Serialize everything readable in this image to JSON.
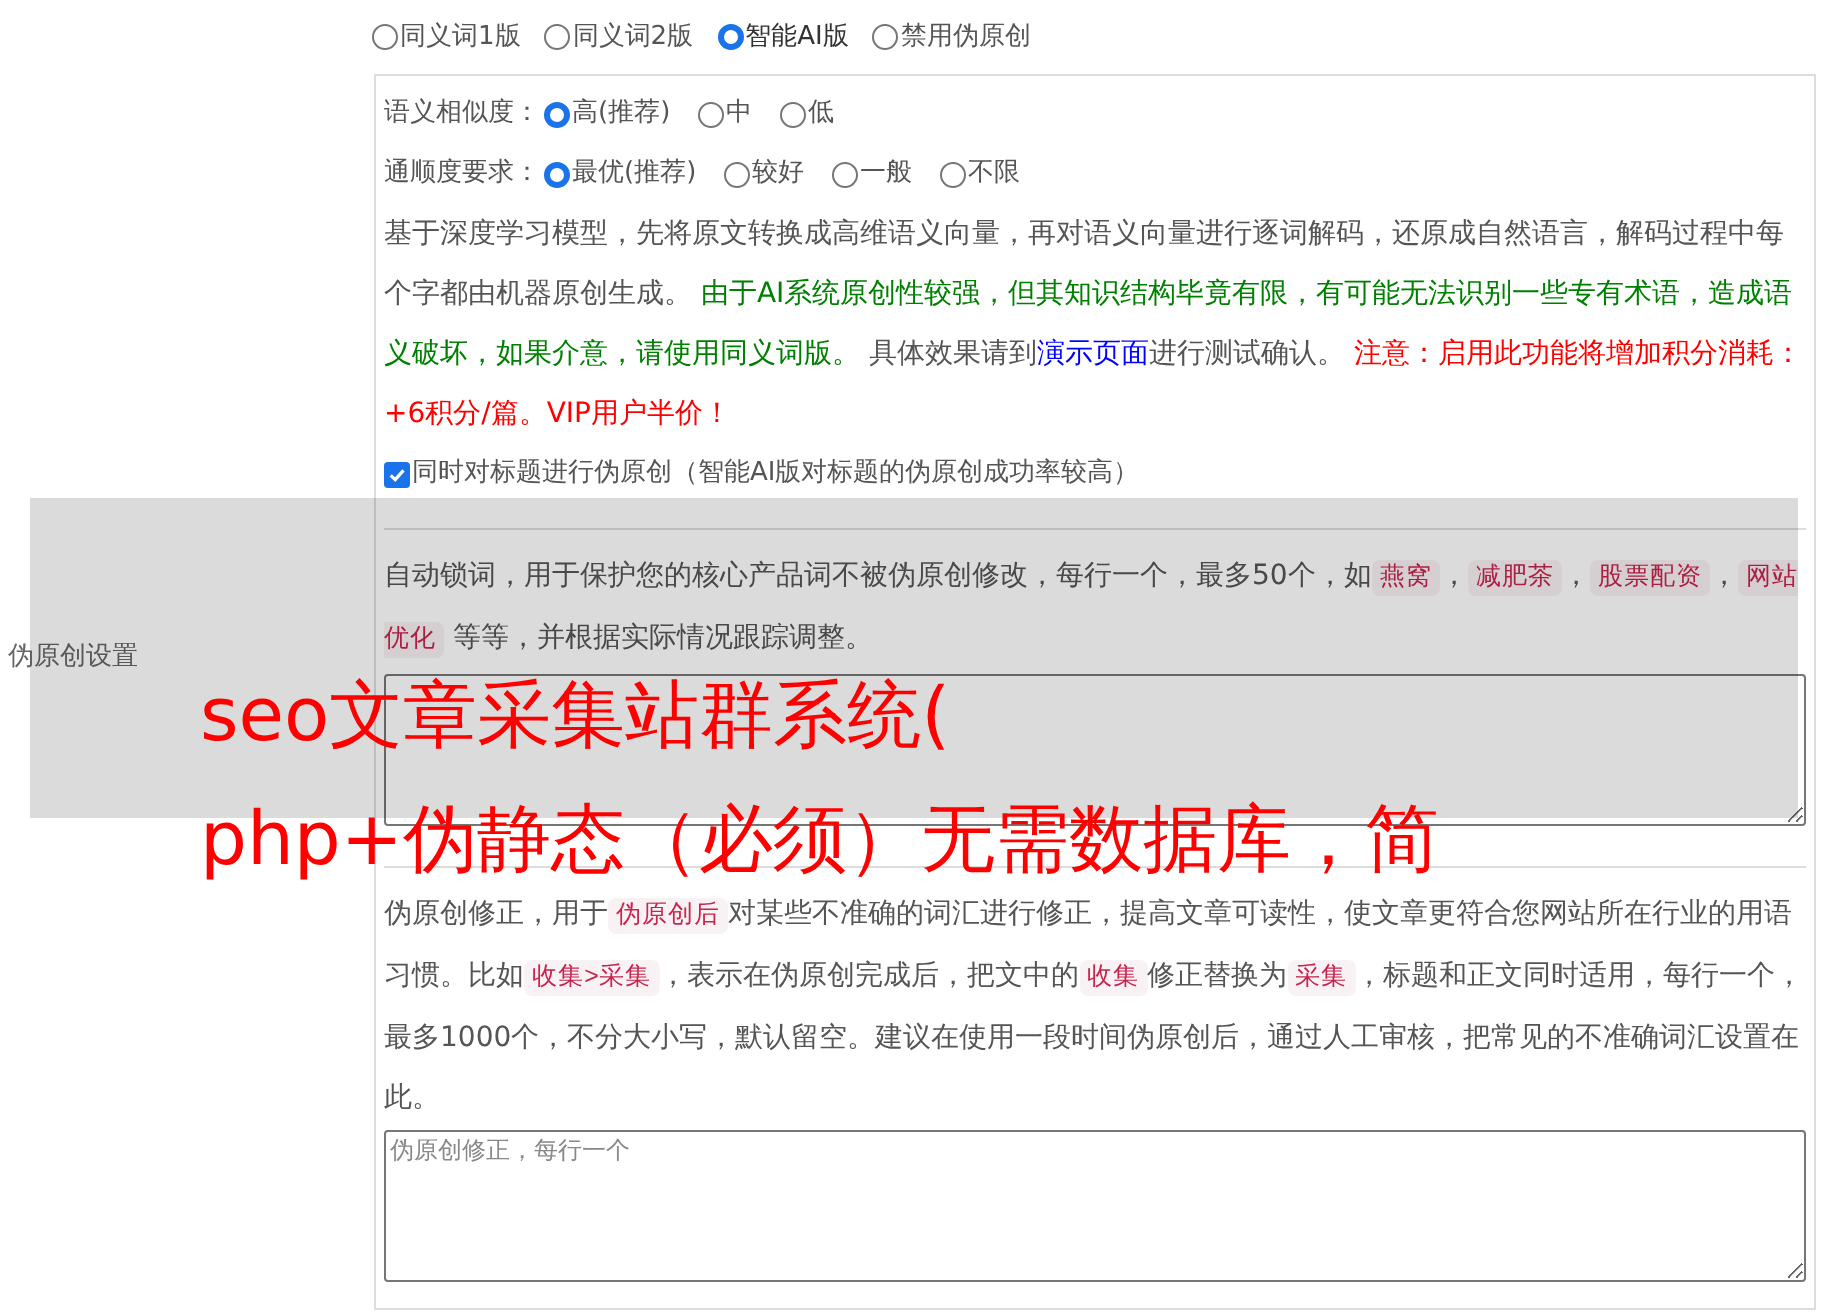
{
  "section_label": "伪原创设置",
  "mode_options": [
    {
      "label": "同义词1版",
      "selected": false
    },
    {
      "label": "同义词2版",
      "selected": false
    },
    {
      "label": "智能AI版",
      "selected": true
    },
    {
      "label": "禁用伪原创",
      "selected": false
    }
  ],
  "settings": [
    {
      "label": "语义相似度：",
      "options": [
        {
          "label": "高(推荐)",
          "selected": true
        },
        {
          "label": "中",
          "selected": false
        },
        {
          "label": "低",
          "selected": false
        }
      ]
    },
    {
      "label": "通顺度要求：",
      "options": [
        {
          "label": "最优(推荐)",
          "selected": true
        },
        {
          "label": "较好",
          "selected": false
        },
        {
          "label": "一般",
          "selected": false
        },
        {
          "label": "不限",
          "selected": false
        }
      ]
    }
  ],
  "ai_description": [
    {
      "kind": "text",
      "text": "基于深度学习模型，先将原文转换成高维语义向量，再对语义向量进行逐词解码，还原成自然语言，解码过程中每个字都由机器原创生成。 "
    },
    {
      "kind": "success",
      "text": "由于AI系统原创性较强，但其知识结构毕竟有限，有可能无法识别一些专有术语，造成语义破坏，如果介意，请使用同义词版。"
    },
    {
      "kind": "text",
      "text": " 具体效果请到"
    },
    {
      "kind": "link",
      "text": "演示页面"
    },
    {
      "kind": "text",
      "text": "进行测试确认。 "
    },
    {
      "kind": "warning",
      "text": "注意：启用此功能将增加积分消耗：+6积分/篇。VIP用户半价！"
    }
  ],
  "title_option": {
    "label": "同时对标题进行伪原创（智能AI版对标题的伪原创成功率较高）",
    "checked": true
  },
  "auto_lock": {
    "description": [
      {
        "kind": "text",
        "text": "自动锁词，用于保护您的核心产品词不被伪原创修改，每行一个，最多50个，如"
      },
      {
        "kind": "code",
        "text": "燕窝"
      },
      {
        "kind": "text",
        "text": "，"
      },
      {
        "kind": "code",
        "text": "减肥茶"
      },
      {
        "kind": "text",
        "text": "，"
      },
      {
        "kind": "code",
        "text": "股票配资"
      },
      {
        "kind": "text",
        "text": "，"
      },
      {
        "kind": "code",
        "text": "网站优化"
      },
      {
        "kind": "text",
        "text": " 等等，并根据实际情况跟踪调整。"
      }
    ]
  },
  "correction": {
    "description": [
      {
        "kind": "text",
        "text": "伪原创修正，用于"
      },
      {
        "kind": "code",
        "text": "伪原创后"
      },
      {
        "kind": "text",
        "text": "对某些不准确的词汇进行修正，提高文章可读性，使文章更符合您网站所在行业的用语习惯。比如"
      },
      {
        "kind": "code",
        "text": "收集>采集"
      },
      {
        "kind": "text",
        "text": "，表示在伪原创完成后，把文中的"
      },
      {
        "kind": "code",
        "text": "收集"
      },
      {
        "kind": "text",
        "text": "修正替换为"
      },
      {
        "kind": "code",
        "text": "采集"
      },
      {
        "kind": "text",
        "text": "，标题和正文同时适用，每行一个，最多1000个，不分大小写，默认留空。建议在使用一段时间伪原创后，通过人工审核，把常见的不准确词汇设置在此。"
      }
    ],
    "placeholder": "伪原创修正，每行一个"
  },
  "overlay_caption": [
    "seo文章采集站群系统(",
    "php+伪静态（必须）无需数据库，简"
  ]
}
